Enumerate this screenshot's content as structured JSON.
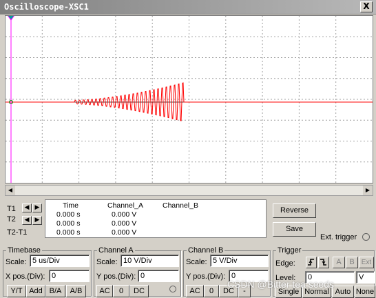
{
  "window": {
    "title": "Oscilloscope-XSC1",
    "close_label": "X"
  },
  "readout": {
    "t1_label": "T1",
    "t2_label": "T2",
    "t2t1_label": "T2-T1",
    "headers": [
      "Time",
      "Channel_A",
      "Channel_B"
    ],
    "rows": [
      {
        "time": "0.000 s",
        "channel_a": "0.000 V",
        "channel_b": ""
      },
      {
        "time": "0.000 s",
        "channel_a": "0.000 V",
        "channel_b": ""
      },
      {
        "time": "0.000 s",
        "channel_a": "0.000 V",
        "channel_b": ""
      }
    ]
  },
  "buttons": {
    "reverse": "Reverse",
    "save": "Save",
    "ext_trigger": "Ext. trigger"
  },
  "timebase": {
    "title": "Timebase",
    "scale_label": "Scale:",
    "scale_value": "5 us/Div",
    "xpos_label": "X pos.(Div):",
    "xpos_value": "0",
    "modes": [
      "Y/T",
      "Add",
      "B/A",
      "A/B"
    ]
  },
  "channel_a": {
    "title": "Channel A",
    "scale_label": "Scale:",
    "scale_value": "10  V/Div",
    "ypos_label": "Y pos.(Div):",
    "ypos_value": "0",
    "coupling": [
      "AC",
      "0",
      "DC"
    ]
  },
  "channel_b": {
    "title": "Channel B",
    "scale_label": "Scale:",
    "scale_value": "5  V/Div",
    "ypos_label": "Y pos.(Div):",
    "ypos_value": "0",
    "coupling": [
      "AC",
      "0",
      "DC",
      "-"
    ]
  },
  "trigger": {
    "title": "Trigger",
    "edge_label": "Edge:",
    "edge_sources": [
      "A",
      "B",
      "Ext"
    ],
    "level_label": "Level:",
    "level_value": "0",
    "level_unit": "V",
    "modes": [
      "Single",
      "Normal",
      "Auto",
      "None"
    ]
  },
  "watermark": "CSDN @Bitter tea seeds",
  "colors": {
    "trace": "#ff0000",
    "grid": "#a0a0a0",
    "cursor_t1": "#ff00ff",
    "cursor_t2": "#00a0a0"
  }
}
